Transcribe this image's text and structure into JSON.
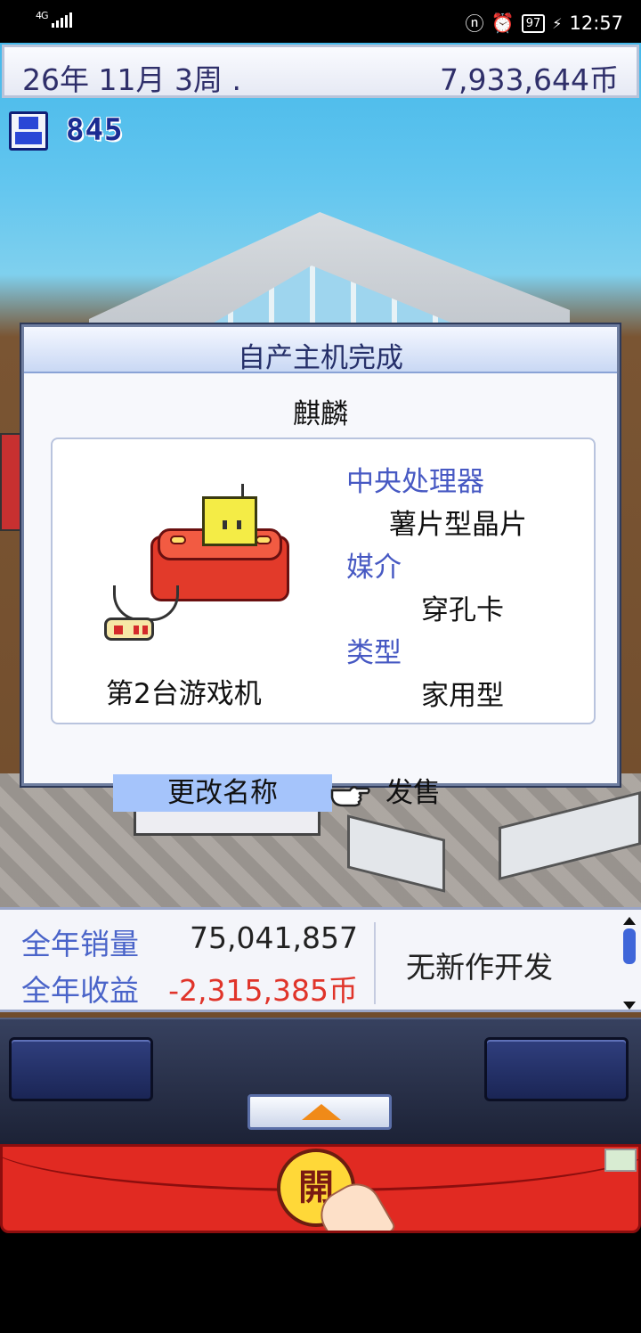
{
  "status_bar": {
    "network": "4G",
    "battery": "97",
    "time": "12:57"
  },
  "top_bar": {
    "date": "26年 11月 3周 .",
    "money": "7,933,644币"
  },
  "research_points": "845",
  "dialog": {
    "title": "自产主机完成",
    "console_name": "麒麟",
    "specs": [
      {
        "label": "中央处理器",
        "value": "薯片型晶片"
      },
      {
        "label": "媒介",
        "value": "穿孔卡"
      },
      {
        "label": "类型",
        "value": "家用型"
      }
    ],
    "console_index": "第2台游戏机",
    "rename_label": "更改名称",
    "sell_label": "发售"
  },
  "stats": {
    "annual_sales_label": "全年销量",
    "annual_sales_value": "75,041,857",
    "annual_revenue_label": "全年收益",
    "annual_revenue_value": "-2,315,385币",
    "message": "无新作开发"
  },
  "ad": {
    "coin_text": "開"
  },
  "colors": {
    "accent_label": "#4759c3",
    "negative": "#e0342a",
    "highlight": "#a5c4fb"
  }
}
